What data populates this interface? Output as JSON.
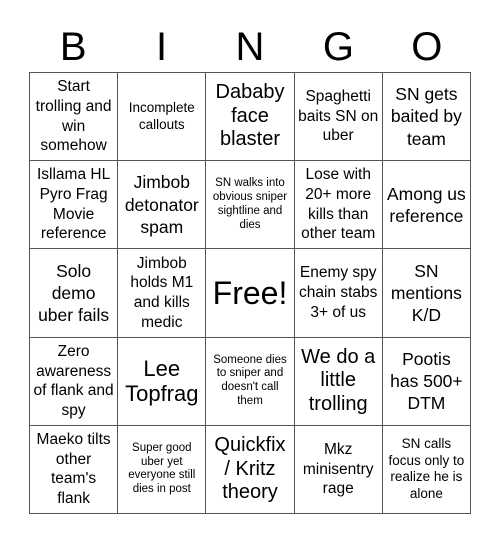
{
  "title_letters": [
    "B",
    "I",
    "N",
    "G",
    "O"
  ],
  "cells": [
    {
      "text": "Start trolling and win somehow",
      "size": "fs-m"
    },
    {
      "text": "Incomplete callouts",
      "size": "fs-s"
    },
    {
      "text": "Dababy face blaster",
      "size": "fs-xl"
    },
    {
      "text": "Spaghetti baits SN on uber",
      "size": "fs-m"
    },
    {
      "text": "SN gets baited by team",
      "size": "fs-l"
    },
    {
      "text": "Isllama HL Pyro Frag Movie reference",
      "size": "fs-m"
    },
    {
      "text": "Jimbob detonator spam",
      "size": "fs-l"
    },
    {
      "text": "SN walks into obvious sniper sightline and dies",
      "size": "fs-xs"
    },
    {
      "text": "Lose with 20+ more kills than other team",
      "size": "fs-m"
    },
    {
      "text": "Among us reference",
      "size": "fs-l"
    },
    {
      "text": "Solo demo uber fails",
      "size": "fs-l"
    },
    {
      "text": "Jimbob holds M1 and kills medic",
      "size": "fs-m"
    },
    {
      "text": "Free!",
      "size": "fs-free"
    },
    {
      "text": "Enemy spy chain stabs 3+ of us",
      "size": "fs-m"
    },
    {
      "text": "SN mentions K/D",
      "size": "fs-l"
    },
    {
      "text": "Zero awareness of flank and spy",
      "size": "fs-m"
    },
    {
      "text": "Lee Topfrag",
      "size": "fs-xxl"
    },
    {
      "text": "Someone dies to sniper and doesn't call them",
      "size": "fs-xs"
    },
    {
      "text": "We do a little trolling",
      "size": "fs-xl"
    },
    {
      "text": "Pootis has 500+ DTM",
      "size": "fs-l"
    },
    {
      "text": "Maeko tilts other team's flank",
      "size": "fs-m"
    },
    {
      "text": "Super good uber yet everyone still dies in post",
      "size": "fs-xs"
    },
    {
      "text": "Quickfix / Kritz theory",
      "size": "fs-xl"
    },
    {
      "text": "Mkz minisentry rage",
      "size": "fs-m"
    },
    {
      "text": "SN calls focus only to realize he is alone",
      "size": "fs-s"
    }
  ]
}
